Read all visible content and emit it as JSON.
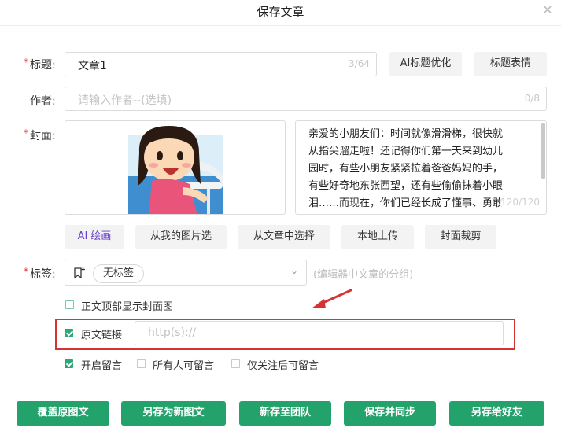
{
  "dialog": {
    "title": "保存文章"
  },
  "title_field": {
    "label": "标题:",
    "value": "文章1",
    "counter": "3/64"
  },
  "title_buttons": {
    "ai_optimize": "AI标题优化",
    "emoji": "标题表情"
  },
  "author_field": {
    "label": "作者:",
    "placeholder": "请输入作者--(选填)",
    "counter": "0/8"
  },
  "cover": {
    "label": "封面:",
    "summary": "亲爱的小朋友们：时间就像滑滑梯，很快就从指尖溜走啦！还记得你们第一天来到幼儿园时，有些小朋友紧紧拉着爸爸妈妈的手，有些好奇地东张西望，还有些偷偷抹着小眼泪……而现在，你们已经长成了懂事、勇敢的小大人啦！",
    "summary_counter": "120/120"
  },
  "picture_buttons": [
    "AI 绘画",
    "从我的图片选",
    "从文章中选择",
    "本地上传",
    "封面裁剪"
  ],
  "tags": {
    "label": "标签:",
    "chip": "无标签",
    "hint": "(编辑器中文章的分组)"
  },
  "options": {
    "show_cover": "正文顶部显示封面图",
    "original_link": "原文链接",
    "link_placeholder": "http(s)://",
    "enable_comments": "开启留言",
    "everyone_comment": "所有人可留言",
    "followers_comment": "仅关注后可留言"
  },
  "footer_buttons": [
    "覆盖原图文",
    "另存为新图文",
    "新存至团队",
    "保存并同步",
    "另存给好友"
  ],
  "colors": {
    "primary_green": "#23a26b",
    "annotation_red": "#d63333",
    "ai_purple": "#6a3fc8"
  }
}
